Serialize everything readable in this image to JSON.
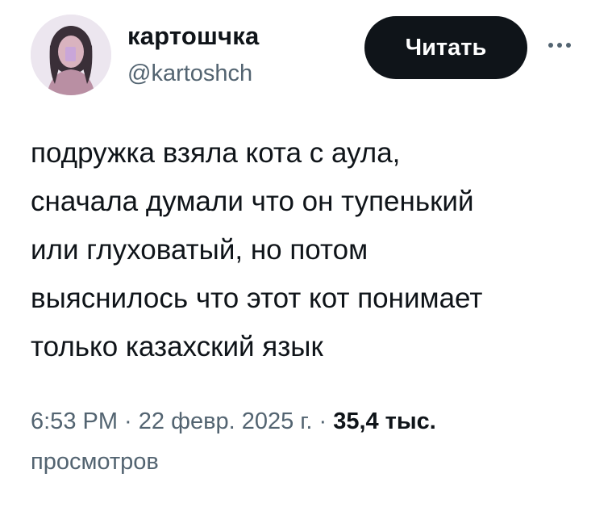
{
  "author": {
    "display_name": "картошчка",
    "handle": "@kartoshch",
    "avatar_icon": "profile-photo"
  },
  "follow_button": {
    "label": "Читать"
  },
  "more_button": {
    "icon": "ellipsis-icon"
  },
  "tweet": {
    "lines": [
      "подружка взяла кота с аула,",
      "сначала думали что он тупенький",
      "или глуховатый, но потом",
      "выяснилось что этот кот понимает",
      "только казахский язык"
    ]
  },
  "meta": {
    "time": "6:53 PM",
    "separator": " · ",
    "date": "22 февр. 2025 г.",
    "views_count": "35,4 тыс.",
    "views_label": "просмотров"
  },
  "colors": {
    "text": "#0f1419",
    "secondary": "#536471",
    "button_bg": "#0f1419",
    "button_text": "#ffffff"
  }
}
